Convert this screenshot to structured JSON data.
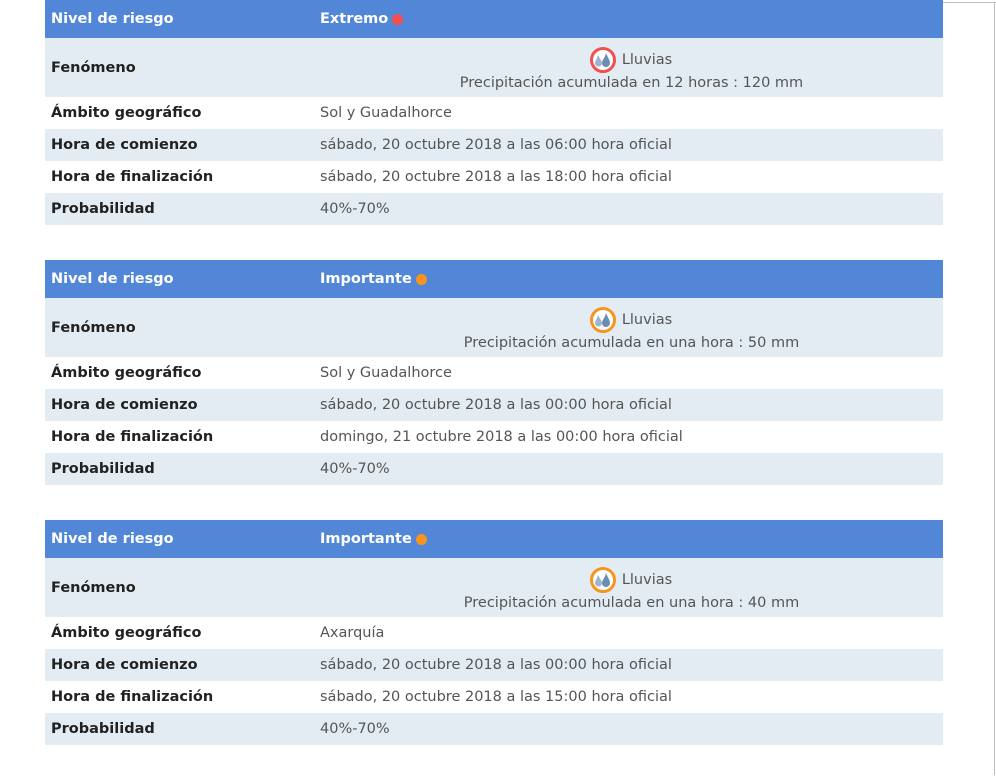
{
  "labels": {
    "nivel": "Nivel de riesgo",
    "fenomeno": "Fenómeno",
    "ambito": "Ámbito geográfico",
    "comienzo": "Hora de comienzo",
    "finalizacion": "Hora de finalización",
    "probabilidad": "Probabilidad"
  },
  "icons": {
    "phenomenon": "rain-drops-icon",
    "level": "level-dot-icon"
  },
  "alerts": [
    {
      "level": "Extremo",
      "level_color": "#f24f4f",
      "phenomenon": "Lluvias",
      "phenomenon_detail": "Precipitación acumulada en 12 horas : 120 mm",
      "area": "Sol y Guadalhorce",
      "start": "sábado, 20 octubre 2018 a las 06:00 hora oficial",
      "end": "sábado, 20 octubre 2018 a las 18:00 hora oficial",
      "probability": "40%-70%"
    },
    {
      "level": "Importante",
      "level_color": "#f6941d",
      "phenomenon": "Lluvias",
      "phenomenon_detail": "Precipitación acumulada en una hora : 50 mm",
      "area": "Sol y Guadalhorce",
      "start": "sábado, 20 octubre 2018 a las 00:00 hora oficial",
      "end": "domingo, 21 octubre 2018 a las 00:00 hora oficial",
      "probability": "40%-70%"
    },
    {
      "level": "Importante",
      "level_color": "#f6941d",
      "phenomenon": "Lluvias",
      "phenomenon_detail": "Precipitación acumulada en una hora : 40 mm",
      "area": "Axarquía",
      "start": "sábado, 20 octubre 2018 a las 00:00 hora oficial",
      "end": "sábado, 20 octubre 2018 a las 15:00 hora oficial",
      "probability": "40%-70%"
    }
  ]
}
